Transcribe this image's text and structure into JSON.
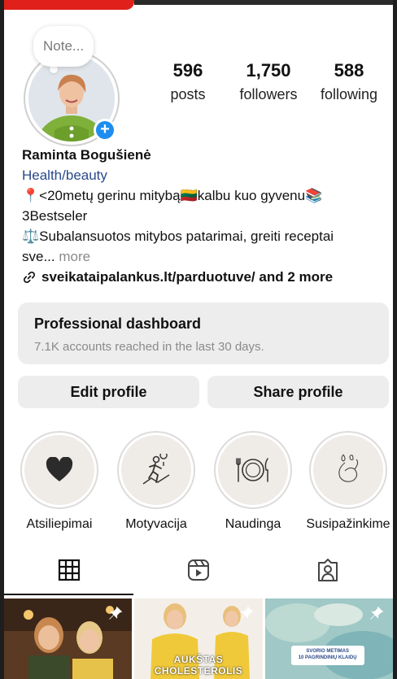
{
  "profile": {
    "note_placeholder": "Note...",
    "name": "Raminta Bogušienė",
    "category": "Health/beauty",
    "bio_line1": "📍<20metų gerinu mitybą🇱🇹kalbu kuo gyvenu📚",
    "bio_line2": "3Bestseler",
    "bio_line3": "⚖️Subalansuotos mitybos patarimai, greiti receptai",
    "bio_line4": "sve...",
    "more_label": " more",
    "link_text": "sveikataipalankus.lt/parduotuve/ and 2 more"
  },
  "stats": [
    {
      "value": "596",
      "label": "posts"
    },
    {
      "value": "1,750",
      "label": "followers"
    },
    {
      "value": "588",
      "label": "following"
    }
  ],
  "dashboard": {
    "title": "Professional dashboard",
    "subtitle": "7.1K accounts reached in the last 30 days."
  },
  "buttons": {
    "edit_profile": "Edit profile",
    "share_profile": "Share profile"
  },
  "highlights": [
    {
      "label": "Atsiliepimai",
      "icon": "heart-icon"
    },
    {
      "label": "Motyvacija",
      "icon": "hiker-icon"
    },
    {
      "label": "Naudinga",
      "icon": "plate-cutlery-icon"
    },
    {
      "label": "Susipažinkime",
      "icon": "flower-drawing-icon"
    }
  ],
  "tabs": [
    {
      "name": "grid",
      "icon": "grid-icon",
      "active": true
    },
    {
      "name": "reels",
      "icon": "reels-icon",
      "active": false
    },
    {
      "name": "tagged",
      "icon": "tagged-user-icon",
      "active": false
    }
  ],
  "posts": [
    {
      "caption": ""
    },
    {
      "caption": "AUKŠTAS CHOLESTEROLIS"
    },
    {
      "card_title": "SVORIO METIMAS",
      "card_sub": "10 PAGRINDINIŲ KLAIDŲ"
    }
  ],
  "colors": {
    "accent_blue": "#1d8ef0",
    "category_blue": "#2a4a8a",
    "button_gray": "#ededed",
    "red_tab": "#e0201b"
  }
}
